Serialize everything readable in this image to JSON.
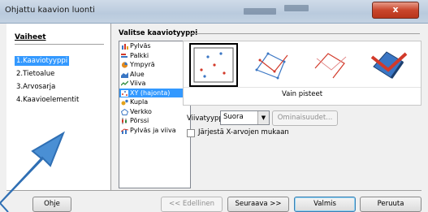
{
  "window": {
    "title": "Ohjattu kaavion luonti",
    "close_label": "x"
  },
  "steps": {
    "heading": "Vaiheet",
    "items": [
      {
        "label": "1.Kaaviotyyppi",
        "active": true
      },
      {
        "label": "2.Tietoalue",
        "active": false
      },
      {
        "label": "3.Arvosarja",
        "active": false
      },
      {
        "label": "4.Kaavioelementit",
        "active": false
      }
    ]
  },
  "main": {
    "section_title": "Valitse kaaviotyyppi",
    "chart_types": [
      {
        "label": "Pylväs",
        "icon": "bar-chart-icon",
        "color": "#3a76c4"
      },
      {
        "label": "Palkki",
        "icon": "horizontal-bar-chart-icon",
        "color": "#d23a2a"
      },
      {
        "label": "Ympyrä",
        "icon": "pie-chart-icon",
        "color": "#e38a1c"
      },
      {
        "label": "Alue",
        "icon": "area-chart-icon",
        "color": "#3a76c4"
      },
      {
        "label": "Viiva",
        "icon": "line-chart-icon",
        "color": "#2a8a3a"
      },
      {
        "label": "XY (hajonta)",
        "icon": "scatter-chart-icon",
        "color": "#d23a2a",
        "selected": true
      },
      {
        "label": "Kupla",
        "icon": "bubble-chart-icon",
        "color": "#e3a21c"
      },
      {
        "label": "Verkko",
        "icon": "net-chart-icon",
        "color": "#3a76c4"
      },
      {
        "label": "Pörssi",
        "icon": "stock-chart-icon",
        "color": "#d23a2a"
      },
      {
        "label": "Pylväs ja viiva",
        "icon": "column-line-chart-icon",
        "color": "#3a76c4"
      }
    ],
    "variant_caption": "Vain pisteet",
    "line_type_label": "Viivatyyppi",
    "line_type_value": "Suora",
    "properties_button": "Ominaisuudet...",
    "sort_checkbox_label": "Järjestä X-arvojen mukaan"
  },
  "footer": {
    "help": "Ohje",
    "previous": "<< Edellinen",
    "next": "Seuraava >>",
    "finish": "Valmis",
    "cancel": "Peruuta"
  },
  "overlay": {
    "arrow_color": "#4a8fd4"
  }
}
